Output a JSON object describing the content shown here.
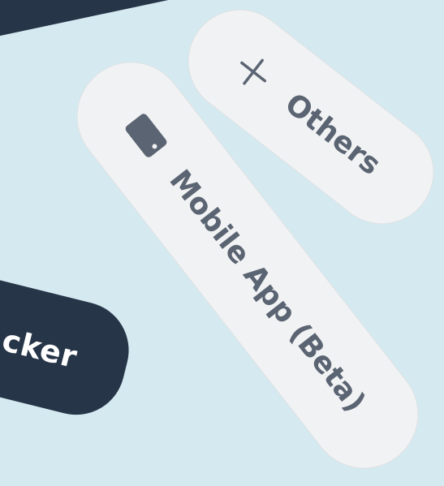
{
  "cards": {
    "dark_top": {
      "label": ""
    },
    "dark_left": {
      "label": "cker"
    },
    "others": {
      "label": "Others",
      "icon": "plus-icon"
    },
    "mobile_app": {
      "label": "Mobile App (Beta)",
      "icon": "mobile-phone-icon"
    }
  },
  "colors": {
    "background": "#d5eaf0",
    "dark_card": "#263548",
    "light_card": "#f1f2f3",
    "light_text": "#5b6472"
  }
}
